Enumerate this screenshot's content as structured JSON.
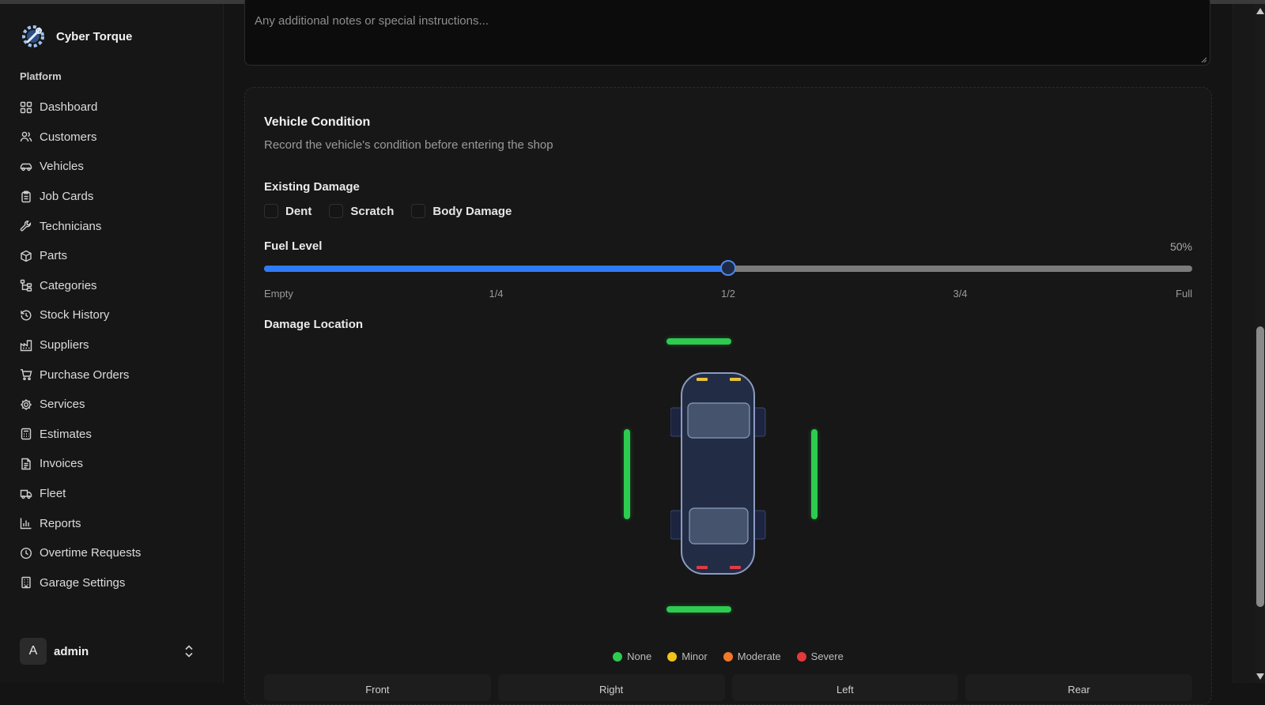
{
  "brand": {
    "name": "Cyber Torque",
    "icon": "gear-logo-icon"
  },
  "sidebar": {
    "section_label": "Platform",
    "items": [
      {
        "label": "Dashboard",
        "icon": "dashboard-icon"
      },
      {
        "label": "Customers",
        "icon": "users-icon"
      },
      {
        "label": "Vehicles",
        "icon": "car-icon"
      },
      {
        "label": "Job Cards",
        "icon": "clipboard-icon"
      },
      {
        "label": "Technicians",
        "icon": "wrench-icon"
      },
      {
        "label": "Parts",
        "icon": "box-icon"
      },
      {
        "label": "Categories",
        "icon": "tree-icon"
      },
      {
        "label": "Stock History",
        "icon": "history-icon"
      },
      {
        "label": "Suppliers",
        "icon": "factory-icon"
      },
      {
        "label": "Purchase Orders",
        "icon": "cart-icon"
      },
      {
        "label": "Services",
        "icon": "cog-icon"
      },
      {
        "label": "Estimates",
        "icon": "calculator-icon"
      },
      {
        "label": "Invoices",
        "icon": "receipt-icon"
      },
      {
        "label": "Fleet",
        "icon": "truck-icon"
      },
      {
        "label": "Reports",
        "icon": "bar-chart-icon"
      },
      {
        "label": "Overtime Requests",
        "icon": "clock-icon"
      },
      {
        "label": "Garage Settings",
        "icon": "building-icon"
      }
    ],
    "user": {
      "avatar_letter": "A",
      "name": "admin"
    }
  },
  "notes": {
    "placeholder": "Any additional notes or special instructions..."
  },
  "vehicle_condition": {
    "title": "Vehicle Condition",
    "subtitle": "Record the vehicle's condition before entering the shop",
    "existing_damage": {
      "label": "Existing Damage",
      "options": [
        {
          "label": "Dent",
          "checked": false
        },
        {
          "label": "Scratch",
          "checked": false
        },
        {
          "label": "Body Damage",
          "checked": false
        }
      ]
    },
    "fuel": {
      "label": "Fuel Level",
      "value_text": "50%",
      "value": 0.5,
      "ticks": [
        "Empty",
        "1/4",
        "1/2",
        "3/4",
        "Full"
      ]
    },
    "damage_location": {
      "label": "Damage Location",
      "legend": [
        {
          "label": "None",
          "color": "#2dcb50"
        },
        {
          "label": "Minor",
          "color": "#f0c419"
        },
        {
          "label": "Moderate",
          "color": "#f0792a"
        },
        {
          "label": "Severe",
          "color": "#e5383b"
        }
      ],
      "tabs": [
        "Front",
        "Right",
        "Left",
        "Rear"
      ]
    }
  },
  "colors": {
    "accent": "#2f7bf5",
    "zone_none": "#2dcb50"
  }
}
